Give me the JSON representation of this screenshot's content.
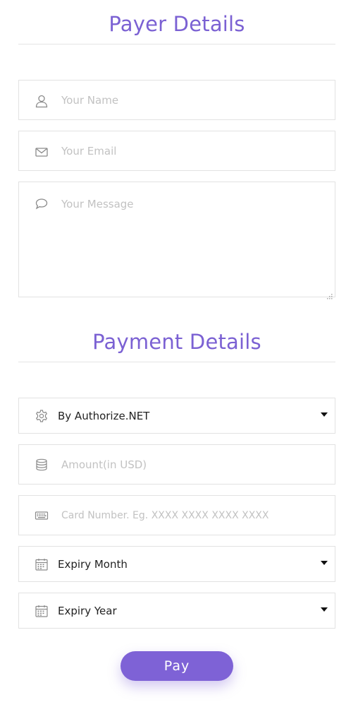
{
  "payer": {
    "title": "Payer Details",
    "name_placeholder": "Your Name",
    "email_placeholder": "Your Email",
    "message_placeholder": "Your Message"
  },
  "payment": {
    "title": "Payment Details",
    "gateway_value": "By Authorize.NET",
    "amount_placeholder": "Amount(in USD)",
    "card_placeholder": "Card Number. Eg. XXXX XXXX XXXX XXXX",
    "expiry_month_value": "Expiry Month",
    "expiry_year_value": "Expiry Year"
  },
  "pay_button_label": "Pay",
  "icons": {
    "name": "user-icon",
    "email": "envelope-icon",
    "message": "speech-bubble-icon",
    "gateway": "gear-icon",
    "amount": "coin-stack-icon",
    "card": "keyboard-icon",
    "month": "calendar-icon",
    "year": "calendar-icon",
    "dropdown": "caret-down-icon"
  },
  "colors": {
    "accent": "#7b61d3",
    "button": "#7e62d6",
    "border": "#e2e2e2",
    "placeholder": "#c2c2c2",
    "icon": "#8a8a8a"
  }
}
